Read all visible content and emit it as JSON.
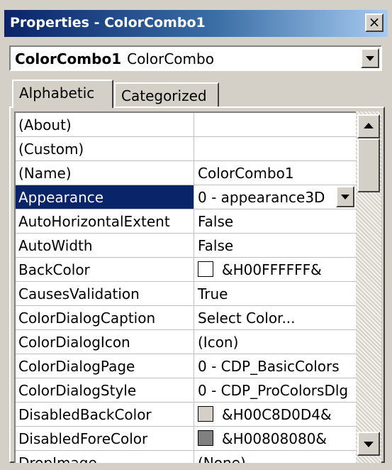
{
  "window": {
    "title": "Properties - ColorCombo1"
  },
  "object_selector": {
    "name": "ColorCombo1",
    "type": "ColorCombo"
  },
  "tabs": [
    {
      "label": "Alphabetic",
      "active": true
    },
    {
      "label": "Categorized",
      "active": false
    }
  ],
  "properties": [
    {
      "name": "(About)",
      "value": ""
    },
    {
      "name": "(Custom)",
      "value": ""
    },
    {
      "name": "(Name)",
      "value": "ColorCombo1"
    },
    {
      "name": "Appearance",
      "value": "0 - appearance3D",
      "selected": true
    },
    {
      "name": "AutoHorizontalExtent",
      "value": "False"
    },
    {
      "name": "AutoWidth",
      "value": "False"
    },
    {
      "name": "BackColor",
      "value": "&H00FFFFFF&",
      "swatch": "#ffffff"
    },
    {
      "name": "CausesValidation",
      "value": "True"
    },
    {
      "name": "ColorDialogCaption",
      "value": "Select Color..."
    },
    {
      "name": "ColorDialogIcon",
      "value": "(Icon)"
    },
    {
      "name": "ColorDialogPage",
      "value": "0 - CDP_BasicColors"
    },
    {
      "name": "ColorDialogStyle",
      "value": "0 - CDP_ProColorsDlg"
    },
    {
      "name": "DisabledBackColor",
      "value": "&H00C8D0D4&",
      "swatch": "#d4d0c8"
    },
    {
      "name": "DisabledForeColor",
      "value": "&H00808080&",
      "swatch": "#808080"
    },
    {
      "name": "DropImage",
      "value": "(None)"
    }
  ],
  "colors": {
    "title_bar_start": "#0a246a",
    "title_bar_end": "#a6caf0",
    "selection": "#0a246a",
    "face": "#d4d0c8"
  },
  "icons": {
    "close": "close-icon",
    "dropdown": "chevron-down-icon",
    "scroll_up": "arrow-up-icon",
    "scroll_down": "arrow-down-icon"
  }
}
